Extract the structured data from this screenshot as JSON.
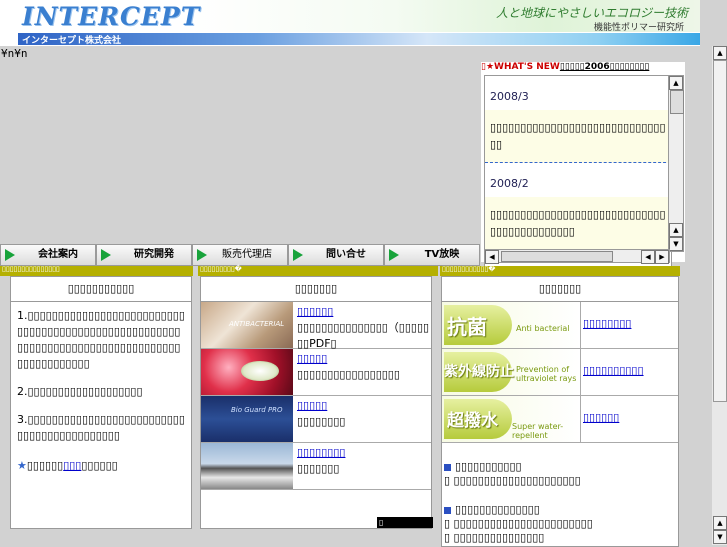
{
  "header": {
    "logo": "INTERCEPT",
    "company_name": "インターセプト株式会社",
    "tagline": "人と地球にやさしいエコロジー技術",
    "subtitle": "機能性ポリマー研究所"
  },
  "stray_text": "¥n¥n",
  "news": {
    "title_prefix": "▯★WHAT'S NEW",
    "title_link": "▯▯▯▯▯2006▯▯▯▯▯▯▯▯",
    "items": [
      {
        "date": "2008/3",
        "text": "▯▯▯▯▯▯▯▯▯▯▯▯▯▯▯▯▯▯▯▯▯▯▯▯▯▯▯▯▯▯▯"
      },
      {
        "date": "2008/2",
        "text": "▯▯▯▯▯▯▯▯▯▯▯▯▯▯▯▯▯▯▯▯▯▯▯▯▯▯▯▯▯▯▯▯▯▯▯▯▯▯▯▯▯▯▯"
      }
    ]
  },
  "nav": [
    "会社案内",
    "研究開発",
    "販売代理店",
    "問い合せ",
    "TV放映"
  ],
  "bars": {
    "left": "▯▯▯▯▯▯▯▯▯▯▯▯▯▯▯",
    "middle": "▯▯▯▯▯▯▯▯▯�",
    "right": "▯▯▯▯▯▯▯▯▯▯▯▯�"
  },
  "panel1": {
    "header": "▯▯▯▯▯▯▯▯▯▯▯",
    "items": [
      "1.▯▯▯▯▯▯▯▯▯▯▯▯▯▯▯▯▯▯▯▯▯▯▯▯▯▯▯▯▯▯▯▯▯▯▯▯▯▯▯▯▯▯▯▯▯▯▯▯▯▯▯▯▯▯▯▯▯▯▯▯▯▯▯▯▯▯▯▯▯▯▯▯▯▯▯▯▯▯▯▯▯▯▯▯▯▯▯▯▯▯▯▯",
      "2.▯▯▯▯▯▯▯▯▯▯▯▯▯▯▯▯▯▯▯",
      "3.▯▯▯▯▯▯▯▯▯▯▯▯▯▯▯▯▯▯▯▯▯▯▯▯▯▯▯▯▯▯▯▯▯▯▯▯▯▯▯▯▯▯▯"
    ],
    "footer_star": "★",
    "footer_pre": "▯▯▯▯▯▯",
    "footer_link": "▯▯▯",
    "footer_post": "▯▯▯▯▯▯"
  },
  "panel2": {
    "header": "▯▯▯▯▯▯▯",
    "rows": [
      {
        "link": "▯▯▯▯▯▯",
        "text": "▯▯▯▯▯▯▯▯▯▯▯▯▯▯▯（▯▯▯▯▯▯▯PDF▯"
      },
      {
        "link": "▯▯▯▯▯",
        "text": "▯▯▯▯▯▯▯▯▯▯▯▯▯▯▯▯▯"
      },
      {
        "link": "▯▯▯▯▯",
        "text": "▯▯▯▯▯▯▯▯"
      },
      {
        "link": "▯▯▯▯▯▯▯▯",
        "text": "▯▯▯▯▯▯▯"
      }
    ],
    "image_captions": [
      "ANTIBACTERIAL",
      "Bio Guard PRO"
    ],
    "footer": "▯"
  },
  "panel3": {
    "header": "▯▯▯▯▯▯▯",
    "rows": [
      {
        "kanji": "抗菌",
        "english": "Anti bacterial",
        "link": "▯▯▯▯▯▯▯▯"
      },
      {
        "kanji": "紫外線防止",
        "english": "Prevention of ultraviolet rays",
        "link": "▯▯▯▯▯▯▯▯▯▯"
      },
      {
        "kanji": "超撥水",
        "english": "Super water-repellent",
        "link": "▯▯▯▯▯▯"
      }
    ],
    "list1_head": "▯▯▯▯▯▯▯▯▯▯▯",
    "list1_items": [
      "▯ ▯▯▯▯▯▯▯▯▯▯▯▯▯▯▯▯▯▯▯▯▯"
    ],
    "list2_head": "▯▯▯▯▯▯▯▯▯▯▯▯▯▯",
    "list2_items": [
      "▯ ▯▯▯▯▯▯▯▯▯▯▯▯▯▯▯▯▯▯▯▯▯▯▯",
      "▯ ▯▯▯▯▯▯▯▯▯▯▯▯▯▯▯"
    ]
  },
  "colors": {
    "accent_olive": "#b5b000",
    "nav_arrow": "#18a33b",
    "link": "#0000cc"
  },
  "icons": {
    "nav": "play-arrow-icon",
    "list": "square-bullet-icon",
    "scroll_up": "arrow-up-icon",
    "scroll_down": "arrow-down-icon"
  }
}
